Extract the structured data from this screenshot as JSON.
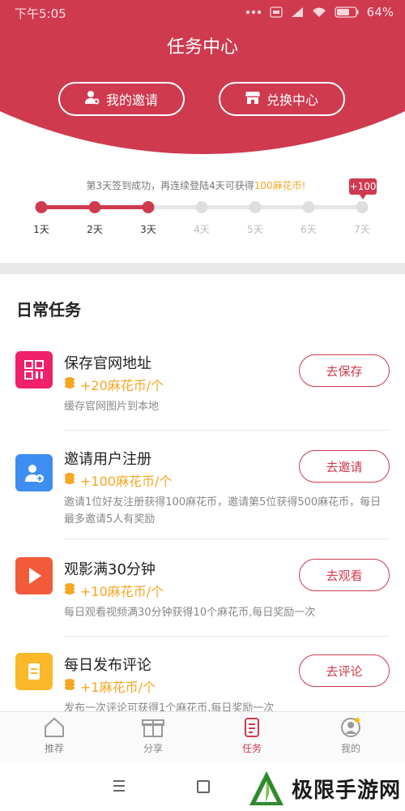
{
  "status_bar": {
    "time": "下午5:05",
    "battery": "64%"
  },
  "header": {
    "title": "任务中心",
    "my_invite_label": "我的邀请",
    "exchange_label": "兑换中心"
  },
  "checkin": {
    "message_prefix": "第3天签到成功，再连续登陆4天可获得",
    "message_highlight": "100麻花币!",
    "bonus_badge": "+100",
    "days": [
      "1天",
      "2天",
      "3天",
      "4天",
      "5天",
      "6天",
      "7天"
    ],
    "completed_days": 3
  },
  "daily": {
    "section_title": "日常任务",
    "tasks": [
      {
        "name": "保存官网地址",
        "reward": "+20麻花币/个",
        "desc": "缓存官网图片到本地",
        "button": "去保存",
        "icon": "qrcode-icon",
        "color": "#f0206b"
      },
      {
        "name": "邀请用户注册",
        "reward": "+100麻花币/个",
        "desc": "邀请1位好友注册获得100麻花币，邀请第5位获得500麻花币，每日最多邀请5人有奖励",
        "button": "去邀请",
        "icon": "add-user-icon",
        "color": "#3d8ef0"
      },
      {
        "name": "观影满30分钟",
        "reward": "+10麻花币/个",
        "desc": "每日观看视频满30分钟获得10个麻花币,每日奖励一次",
        "button": "去观看",
        "icon": "play-icon",
        "color": "#f25b3a"
      },
      {
        "name": "每日发布评论",
        "reward": "+1麻花币/个",
        "desc": "发布一次评论可获得1个麻花币,每日奖励一次",
        "button": "去评论",
        "icon": "comment-doc-icon",
        "color": "#fbb829"
      }
    ]
  },
  "bottom_nav": {
    "items": [
      {
        "label": "推荐",
        "icon": "home-icon"
      },
      {
        "label": "分享",
        "icon": "gift-icon"
      },
      {
        "label": "任务",
        "icon": "task-icon"
      },
      {
        "label": "我的",
        "icon": "profile-icon"
      }
    ],
    "active_index": 2
  },
  "watermark": {
    "text": "极限手游网"
  },
  "colors": {
    "brand": "#cf3a4f",
    "reward": "#f5a623"
  }
}
